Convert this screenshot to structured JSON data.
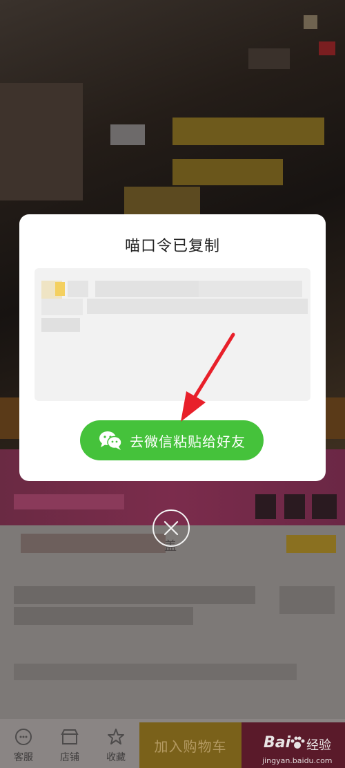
{
  "modal": {
    "title": "喵口令已复制",
    "share_button_label": "去微信粘贴给好友"
  },
  "bottom_bar": {
    "items": [
      {
        "label": "客服",
        "icon": "customer-service-icon"
      },
      {
        "label": "店铺",
        "icon": "store-icon"
      },
      {
        "label": "收藏",
        "icon": "star-icon"
      }
    ],
    "add_to_cart_label": "加入购物车"
  },
  "watermark": {
    "brand": "Bai",
    "brand_suffix": "经验",
    "site": "jingyan.baidu.com"
  },
  "background_fragment": "盖",
  "colors": {
    "wechat_green": "#45c23b",
    "arrow_red": "#e8202a"
  }
}
